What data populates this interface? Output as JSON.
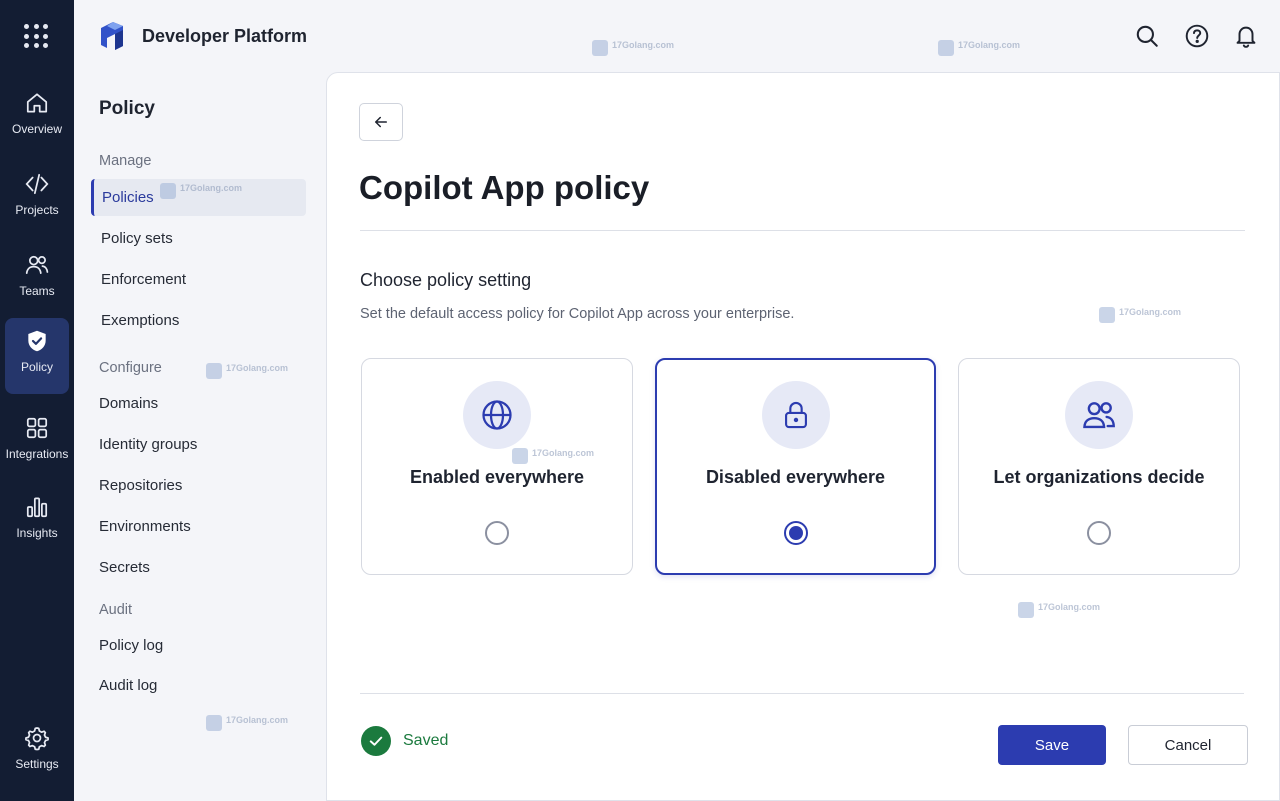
{
  "header": {
    "brand_name": "Developer Platform"
  },
  "rail": {
    "items": [
      {
        "label": "Overview",
        "icon": "home-icon"
      },
      {
        "label": "Projects",
        "icon": "code-icon"
      },
      {
        "label": "Teams",
        "icon": "users-icon"
      },
      {
        "label": "Policy",
        "icon": "shield-check-icon",
        "active": true
      },
      {
        "label": "Integrations",
        "icon": "grid-icon"
      },
      {
        "label": "Insights",
        "icon": "bar-chart-icon"
      },
      {
        "label": "Settings",
        "icon": "gear-icon"
      }
    ]
  },
  "subnav": {
    "title": "Policy",
    "sections": [
      {
        "label": "Manage",
        "items": [
          "Policies",
          "Policy sets",
          "Enforcement",
          "Exemptions"
        ]
      },
      {
        "label": "Configure",
        "items": [
          "Domains",
          "Identity groups",
          "Repositories",
          "Environments",
          "Secrets"
        ]
      },
      {
        "label": "Audit",
        "items": [
          "Policy log",
          "Audit log"
        ]
      }
    ],
    "active_item": "Policies"
  },
  "main": {
    "title": "Copilot App policy",
    "section_title": "Choose policy setting",
    "section_desc": "Set the default access policy for Copilot App across your enterprise.",
    "options": [
      {
        "label": "Enabled everywhere",
        "icon": "globe-icon",
        "selected": false
      },
      {
        "label": "Disabled everywhere",
        "icon": "lock-icon",
        "selected": true
      },
      {
        "label": "Let organizations decide",
        "icon": "users-icon",
        "selected": false
      }
    ],
    "status_text": "Saved",
    "save_label": "Save",
    "cancel_label": "Cancel"
  },
  "watermark": {
    "text": "17Golang.com"
  },
  "colors": {
    "rail_bg": "#131d33",
    "accent": "#2c3cb0",
    "success": "#1b7a3e"
  }
}
